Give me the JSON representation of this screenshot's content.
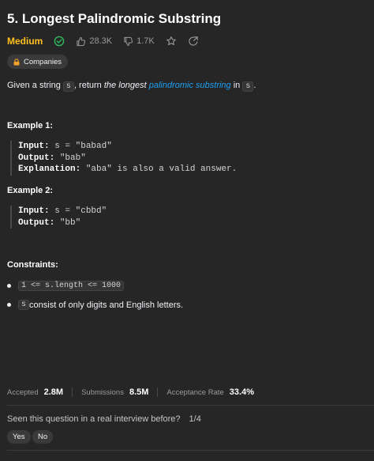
{
  "problem": {
    "title": "5. Longest Palindromic Substring",
    "difficulty": "Medium",
    "likes": "28.3K",
    "dislikes": "1.7K",
    "companies_label": "Companies"
  },
  "description": {
    "p1": "Given a string ",
    "code1": "s",
    "p2": ", return ",
    "em": "the longest",
    "p3": " ",
    "link": "palindromic substring",
    "p4": " in ",
    "code2": "s",
    "p5": "."
  },
  "examples": [
    {
      "heading": "Example 1:",
      "input_label": "Input:",
      "input_value": " s = \"babad\"",
      "output_label": "Output:",
      "output_value": " \"bab\"",
      "explanation_label": "Explanation:",
      "explanation_value": " \"aba\" is also a valid answer."
    },
    {
      "heading": "Example 2:",
      "input_label": "Input:",
      "input_value": " s = \"cbbd\"",
      "output_label": "Output:",
      "output_value": " \"bb\""
    }
  ],
  "constraints": {
    "heading": "Constraints:",
    "c1_code": "1 <= s.length <= 1000",
    "c2_code": "s",
    "c2_text": " consist of only digits and English letters."
  },
  "stats": {
    "accepted_label": "Accepted",
    "accepted_value": "2.8M",
    "submissions_label": "Submissions",
    "submissions_value": "8.5M",
    "rate_label": "Acceptance Rate",
    "rate_value": "33.4%"
  },
  "interview": {
    "question": "Seen this question in a real interview before?",
    "page": "1/4",
    "yes": "Yes",
    "no": "No"
  },
  "colors": {
    "background": "#262626",
    "medium": "#ffc01e",
    "link": "#1da1f2",
    "solved_check": "#2cbb5d"
  }
}
